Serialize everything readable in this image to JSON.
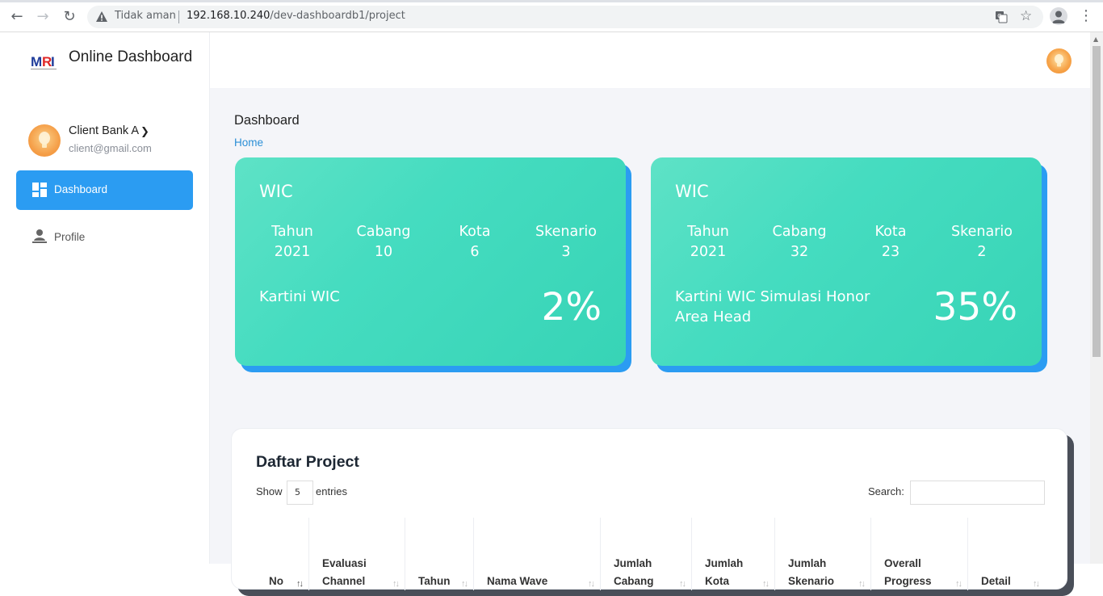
{
  "browser": {
    "warning_text": "Tidak aman",
    "url_host": "192.168.10.240",
    "url_path": "/dev-dashboardb1/project"
  },
  "sidebar": {
    "brand": "Online Dashboard",
    "user_name": "Client Bank A",
    "user_email": "client@gmail.com",
    "nav": [
      {
        "label": "Dashboard",
        "icon": "dashboard-icon",
        "active": true
      },
      {
        "label": "Profile",
        "icon": "profile-icon",
        "active": false
      }
    ]
  },
  "main": {
    "page_title": "Dashboard",
    "breadcrumb": "Home",
    "cards": [
      {
        "title": "WIC",
        "stats": [
          {
            "label": "Tahun",
            "value": "2021"
          },
          {
            "label": "Cabang",
            "value": "10"
          },
          {
            "label": "Kota",
            "value": "6"
          },
          {
            "label": "Skenario",
            "value": "3"
          }
        ],
        "name": "Kartini WIC",
        "percent": "2%"
      },
      {
        "title": "WIC",
        "stats": [
          {
            "label": "Tahun",
            "value": "2021"
          },
          {
            "label": "Cabang",
            "value": "32"
          },
          {
            "label": "Kota",
            "value": "23"
          },
          {
            "label": "Skenario",
            "value": "2"
          }
        ],
        "name": "Kartini WIC Simulasi Honor Area Head",
        "percent": "35%"
      }
    ],
    "project_table": {
      "title": "Daftar Project",
      "show_label": "Show",
      "entries_value": "5",
      "entries_label": "entries",
      "search_label": "Search:",
      "columns": [
        "No",
        "Evaluasi Channel",
        "Tahun",
        "Nama Wave",
        "Jumlah Cabang",
        "Jumlah Kota",
        "Jumlah Skenario",
        "Overall Progress",
        "Detail"
      ]
    }
  },
  "colors": {
    "accent": "#2b9cf2",
    "card_teal": "#45dcc0",
    "link": "#2b8fd6"
  }
}
